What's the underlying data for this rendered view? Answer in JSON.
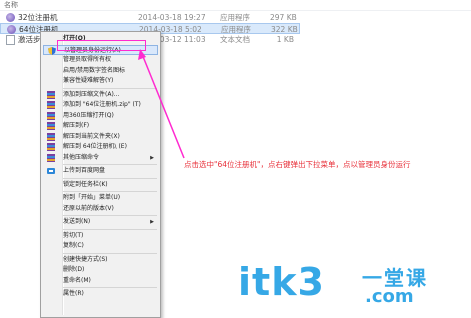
{
  "explorer": {
    "column_name": "名称",
    "files": [
      {
        "name": "32位注册机",
        "date": "2014-03-18 19:27",
        "type": "应用程序",
        "size": "297 KB",
        "icon": "app-icon",
        "selected": false
      },
      {
        "name": "64位注册机",
        "date": "2014-03-18 5:02",
        "type": "应用程序",
        "size": "322 KB",
        "icon": "app-icon",
        "selected": true
      },
      {
        "name": "激活步骤",
        "date": "2014-03-12 11:03",
        "type": "文本文档",
        "size": "1 KB",
        "icon": "text-file-icon",
        "selected": false
      }
    ]
  },
  "context_menu": {
    "items": [
      {
        "label": "打开(O)",
        "bold": true
      },
      {
        "label": "以管理员身份运行(A)",
        "highlighted": true,
        "icon": "shield-icon"
      },
      {
        "label": "管理员取得所有权"
      },
      {
        "label": "启用/禁用数字签名图标"
      },
      {
        "label": "兼容性疑难解答(Y)"
      },
      {
        "sep": true
      },
      {
        "label": "添加到压缩文件(A)...",
        "icon": "archive-icon"
      },
      {
        "label": "添加到 \"64位注册机.zip\" (T)",
        "icon": "archive-icon"
      },
      {
        "label": "用360压缩打开(Q)",
        "icon": "archive-icon"
      },
      {
        "label": "解压到(F)",
        "icon": "archive-icon"
      },
      {
        "label": "解压到当前文件夹(X)",
        "icon": "archive-icon"
      },
      {
        "label": "解压到 64位注册机\\ (E)",
        "icon": "archive-icon"
      },
      {
        "label": "其他压缩命令",
        "icon": "archive-icon",
        "submenu": true
      },
      {
        "sep": true
      },
      {
        "label": "上传到百度网盘",
        "icon": "cloud-icon"
      },
      {
        "sep": true
      },
      {
        "label": "锁定到任务栏(K)"
      },
      {
        "sep": true
      },
      {
        "label": "附到「开始」菜单(U)"
      },
      {
        "label": "还原以前的版本(V)"
      },
      {
        "sep": true
      },
      {
        "label": "发送到(N)",
        "submenu": true
      },
      {
        "sep": true
      },
      {
        "label": "剪切(T)"
      },
      {
        "label": "复制(C)"
      },
      {
        "sep": true
      },
      {
        "label": "创建快捷方式(S)"
      },
      {
        "label": "删除(D)"
      },
      {
        "label": "重命名(M)"
      },
      {
        "sep": true
      },
      {
        "label": "属性(R)"
      }
    ]
  },
  "annotation": {
    "text": "点击选中\"64位注册机\"，点右键弹出下拉菜单，点以管理员身份运行",
    "color": "#e8303a",
    "arrow_color": "#ff2ad0"
  },
  "watermark": {
    "main": "itk3",
    "cn": "一堂课",
    "domain": ".com",
    "color": "#36a8e6"
  }
}
